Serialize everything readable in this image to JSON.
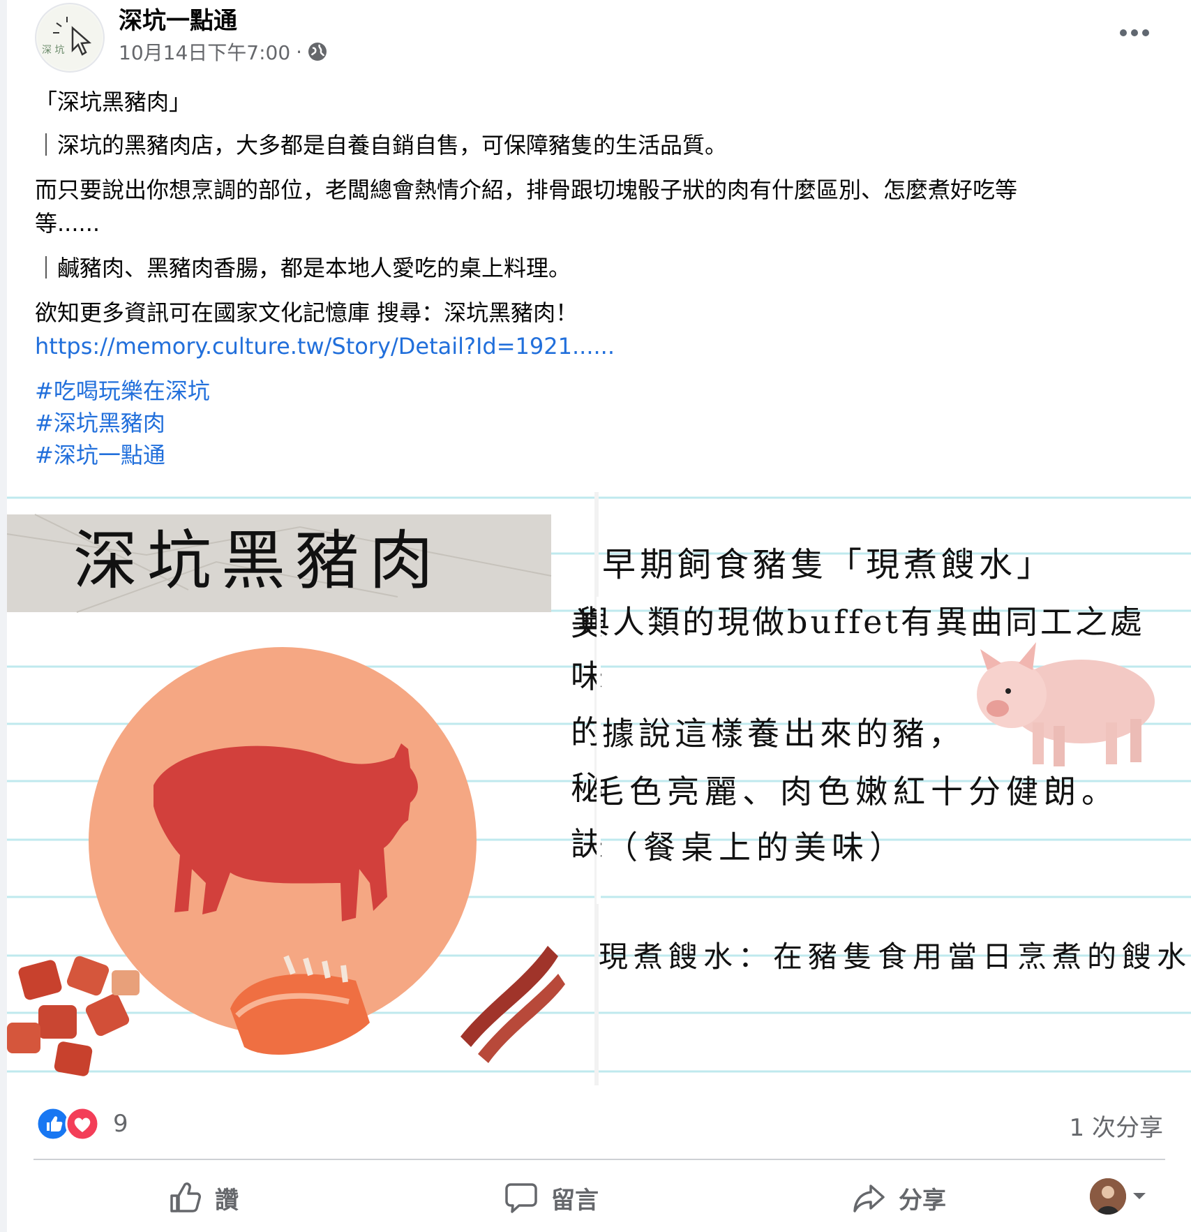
{
  "header": {
    "page_name": "深坑一點通",
    "timestamp": "10月14日下午7:00",
    "separator": "·",
    "avatar_text": "深 坑"
  },
  "post": {
    "title": "「深坑黑豬肉」",
    "para1": "｜深坑的黑豬肉店，大多都是自養自銷自售，可保障豬隻的生活品質。",
    "para2_line1": "而只要說出你想烹調的部位，老闆總會熱情介紹，排骨跟切塊骰子狀的肉有什麼區別、怎麼煮好吃等",
    "para2_line2": "等......",
    "para3": "｜鹹豬肉、黑豬肉香腸，都是本地人愛吃的桌上料理。",
    "para4": "欲知更多資訊可在國家文化記憶庫 搜尋：深坑黑豬肉！",
    "link": "https://memory.culture.tw/Story/Detail?Id=1921......",
    "hashtags": [
      "#吃喝玩樂在深坑",
      "#深坑黑豬肉",
      "#深坑一點通"
    ]
  },
  "media": {
    "left_title": "深坑黑豬肉",
    "right_lines": [
      "早期飼食豬隻「現煮餿水」",
      "與人類的現做buffet有異曲同工之處",
      "據說這樣養出來的豬，",
      "毛色亮麗、肉色嫩紅十分健朗。",
      "（餐桌上的美味）",
      "現煮餿水：在豬隻食用當日烹煮的餿水"
    ],
    "peek_chars": [
      "美",
      "味",
      "的",
      "秘",
      "訣"
    ],
    "colors": {
      "circle": "#f5a783",
      "pig": "#d2403c",
      "rule": "#bfe9ee"
    }
  },
  "footer": {
    "reaction_count": "9",
    "shares": "1 次分享",
    "like_label": "讚",
    "comment_label": "留言",
    "share_label": "分享"
  }
}
